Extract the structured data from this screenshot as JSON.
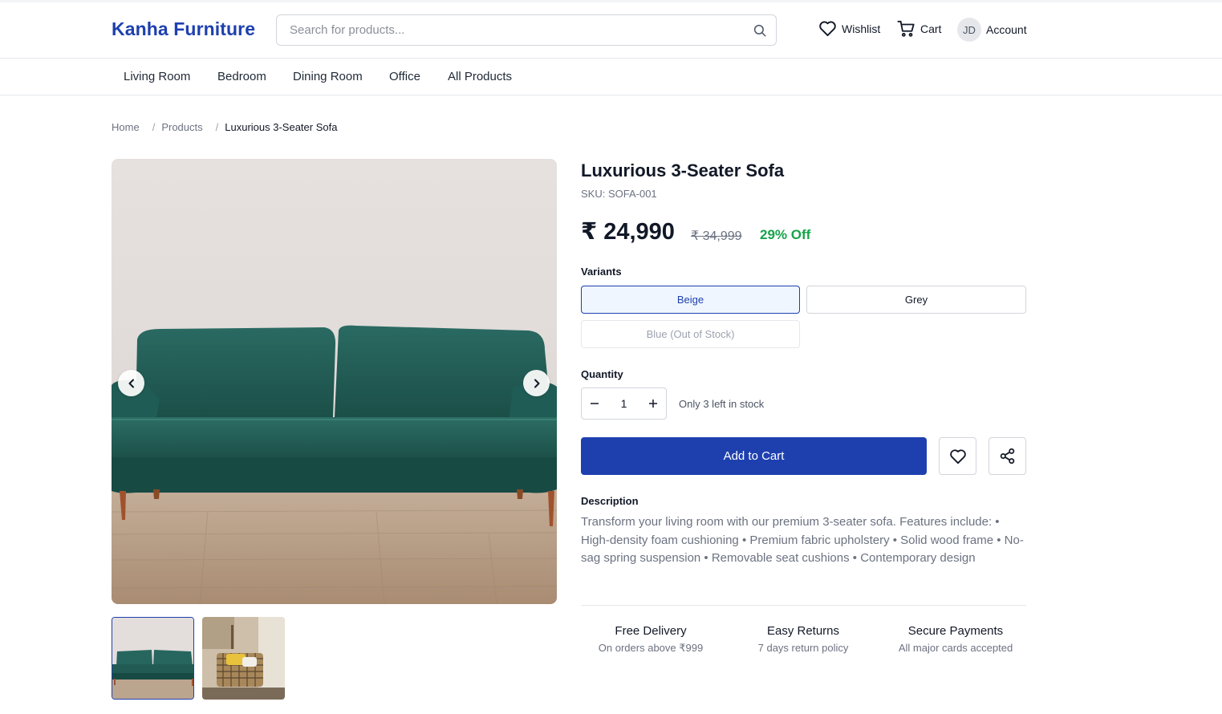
{
  "header": {
    "logo": "Kanha Furniture",
    "search_placeholder": "Search for products...",
    "wishlist_label": "Wishlist",
    "cart_label": "Cart",
    "account_initials": "JD",
    "account_label": "Account"
  },
  "nav": {
    "items": [
      {
        "label": "Living Room"
      },
      {
        "label": "Bedroom"
      },
      {
        "label": "Dining Room"
      },
      {
        "label": "Office"
      },
      {
        "label": "All Products"
      }
    ]
  },
  "breadcrumb": {
    "items": [
      "Home",
      "Products",
      "Luxurious 3-Seater Sofa"
    ],
    "separator": "/"
  },
  "product": {
    "title": "Luxurious 3-Seater Sofa",
    "sku": "SKU: SOFA-001",
    "price": "₹ 24,990",
    "original_price": "₹ 34,999",
    "discount": "29% Off",
    "variants_label": "Variants",
    "variants": [
      {
        "label": "Beige",
        "selected": true
      },
      {
        "label": "Grey",
        "selected": false
      },
      {
        "label": "Blue (Out of Stock)",
        "selected": false
      }
    ],
    "quantity_label": "Quantity",
    "quantity": "1",
    "stock_note": "Only 3 left in stock",
    "add_to_cart": "Add to Cart",
    "description_label": "Description",
    "description": "Transform your living room with our premium 3-seater sofa. Features include: • High-density foam cushioning • Premium fabric upholstery • Solid wood frame • No-sag spring suspension • Removable seat cushions • Contemporary design"
  },
  "features": [
    {
      "title": "Free Delivery",
      "subtitle": "On orders above ₹999"
    },
    {
      "title": "Easy Returns",
      "subtitle": "7 days return policy"
    },
    {
      "title": "Secure Payments",
      "subtitle": "All major cards accepted"
    }
  ],
  "icons": {
    "search": "search-icon",
    "wishlist": "heart-icon",
    "cart": "cart-icon",
    "prev": "chevron-left-icon",
    "next": "chevron-right-icon",
    "minus": "minus-icon",
    "plus": "plus-icon",
    "share": "share-icon"
  },
  "colors": {
    "brand": "#1e40af",
    "discount": "#16a34a",
    "sofa": "#1f5c55"
  }
}
